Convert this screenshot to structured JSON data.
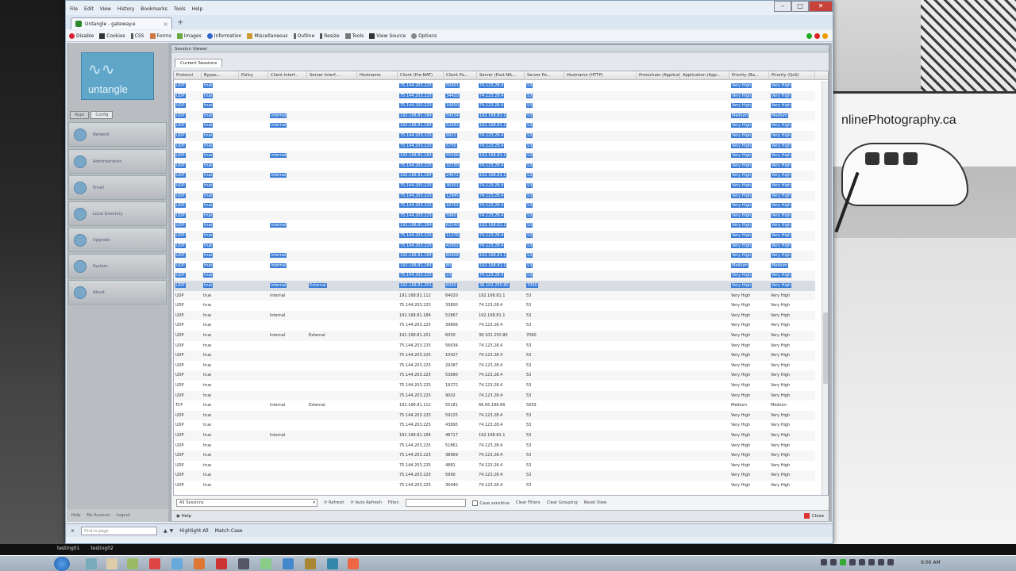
{
  "menu": [
    "File",
    "Edit",
    "View",
    "History",
    "Bookmarks",
    "Tools",
    "Help"
  ],
  "tab": {
    "title": "Untangle - gateway.e"
  },
  "toolbar": [
    "Disable",
    "Cookies",
    "CSS",
    "Forms",
    "Images",
    "Information",
    "Miscellaneous",
    "Outline",
    "Resize",
    "Tools",
    "View Source",
    "Options"
  ],
  "app": {
    "logo": "untangle",
    "tabs": [
      "Apps",
      "Config"
    ],
    "nav": [
      "Network",
      "Administration",
      "Email",
      "Local Directory",
      "Upgrade",
      "System",
      "About"
    ],
    "bottom": [
      "Help",
      "My Account",
      "Logout"
    ]
  },
  "session_viewer": {
    "title": "Session Viewer",
    "tab": "Current Sessions",
    "columns": [
      "Protocol",
      "Bypas...",
      "Policy",
      "Client Interf...",
      "Server Interf...",
      "Hostname",
      "Client (Pre-NAT)",
      "Client Po...",
      "Server (Post-NA...",
      "Server Po...",
      "Hostname (HTTP)",
      "Protochain (Application ...",
      "Application (App...",
      "Priority (Ba...",
      "Priority (QoS)"
    ],
    "selected_rows": [
      [
        "UDP",
        "true",
        "",
        "",
        "",
        "",
        "75.144.203.225",
        "50001",
        "74.123.28.4",
        "53",
        "Very High",
        "Very High"
      ],
      [
        "UDP",
        "true",
        "",
        "",
        "",
        "",
        "75.144.203.225",
        "34420",
        "74.123.28.4",
        "53",
        "Very High",
        "Very High"
      ],
      [
        "UDP",
        "true",
        "",
        "",
        "",
        "",
        "75.144.203.225",
        "16850",
        "74.123.28.4",
        "53",
        "Very High",
        "Very High"
      ],
      [
        "UDP",
        "true",
        "",
        "Internal",
        "",
        "",
        "192.168.81.184",
        "59534",
        "192.168.81.1",
        "53",
        "Medium",
        "Medium"
      ],
      [
        "UDP",
        "true",
        "",
        "Internal",
        "",
        "",
        "192.168.81.184",
        "52993",
        "192.168.81.1",
        "53",
        "Very High",
        "Very High"
      ],
      [
        "UDP",
        "true",
        "",
        "",
        "",
        "",
        "75.144.203.225",
        "9922",
        "74.123.28.4",
        "53",
        "Very High",
        "Very High"
      ],
      [
        "UDP",
        "true",
        "",
        "",
        "",
        "",
        "75.144.203.225",
        "5750",
        "74.123.28.4",
        "53",
        "Very High",
        "Very High"
      ],
      [
        "UDP",
        "true",
        "",
        "Internal",
        "",
        "",
        "192.168.81.184",
        "55596",
        "192.168.81.1",
        "53",
        "Very High",
        "Very High"
      ],
      [
        "UDP",
        "true",
        "",
        "",
        "",
        "",
        "75.144.203.225",
        "32150",
        "74.123.28.4",
        "53",
        "Very High",
        "Very High"
      ],
      [
        "UDP",
        "true",
        "",
        "Internal",
        "",
        "",
        "192.168.81.184",
        "24672",
        "192.168.81.1",
        "53",
        "Very High",
        "Very High"
      ],
      [
        "UDP",
        "true",
        "",
        "",
        "",
        "",
        "75.144.203.225",
        "36301",
        "74.123.28.4",
        "53",
        "Very High",
        "Very High"
      ],
      [
        "UDP",
        "true",
        "",
        "",
        "",
        "",
        "75.144.203.225",
        "12945",
        "74.123.28.4",
        "53",
        "Very High",
        "Very High"
      ],
      [
        "UDP",
        "true",
        "",
        "",
        "",
        "",
        "75.144.203.225",
        "16702",
        "74.123.28.4",
        "53",
        "Very High",
        "Very High"
      ],
      [
        "UDP",
        "true",
        "",
        "",
        "",
        "",
        "75.144.203.225",
        "5960",
        "74.123.28.4",
        "53",
        "Very High",
        "Very High"
      ],
      [
        "UDP",
        "true",
        "",
        "Internal",
        "",
        "",
        "192.168.81.184",
        "62240",
        "192.168.81.1",
        "53",
        "Very High",
        "Very High"
      ],
      [
        "UDP",
        "true",
        "",
        "",
        "",
        "",
        "75.144.203.225",
        "11276",
        "74.123.28.4",
        "53",
        "Very High",
        "Very High"
      ],
      [
        "UDP",
        "true",
        "",
        "",
        "",
        "",
        "75.144.203.225",
        "42002",
        "74.123.28.4",
        "53",
        "Very High",
        "Very High"
      ],
      [
        "UDP",
        "true",
        "",
        "Internal",
        "",
        "",
        "192.168.81.184",
        "60408",
        "192.168.81.1",
        "53",
        "Very High",
        "Very High"
      ],
      [
        "UDP",
        "true",
        "",
        "Internal",
        "",
        "",
        "192.168.81.184",
        "80",
        "192.168.81.1",
        "53",
        "Medium",
        "Medium"
      ],
      [
        "UDP",
        "true",
        "",
        "",
        "",
        "",
        "75.144.203.225",
        "23",
        "74.123.28.4",
        "53",
        "Very High",
        "Very High"
      ],
      [
        "UDP",
        "true",
        "",
        "Internal",
        "External",
        "",
        "192.168.81.201",
        "6050",
        "38.102.250.80",
        "7060",
        "Very High",
        "Very High"
      ]
    ],
    "rows": [
      [
        "UDP",
        "true",
        "",
        "Internal",
        "",
        "",
        "192.168.81.112",
        "64020",
        "192.168.81.1",
        "53",
        "Very High",
        "Very High"
      ],
      [
        "UDP",
        "true",
        "",
        "",
        "",
        "",
        "75.144.203.225",
        "33800",
        "74.123.28.4",
        "53",
        "Very High",
        "Very High"
      ],
      [
        "UDP",
        "true",
        "",
        "Internal",
        "",
        "",
        "192.168.81.184",
        "52867",
        "192.168.81.1",
        "53",
        "Very High",
        "Very High"
      ],
      [
        "UDP",
        "true",
        "",
        "",
        "",
        "",
        "75.144.203.225",
        "39806",
        "74.123.28.4",
        "53",
        "Very High",
        "Very High"
      ],
      [
        "UDP",
        "true",
        "",
        "Internal",
        "External",
        "",
        "192.168.81.201",
        "6050",
        "38.102.250.80",
        "7060",
        "Very High",
        "Very High"
      ],
      [
        "UDP",
        "true",
        "",
        "",
        "",
        "",
        "75.144.203.225",
        "56634",
        "74.123.28.4",
        "53",
        "Very High",
        "Very High"
      ],
      [
        "UDP",
        "true",
        "",
        "",
        "",
        "",
        "75.144.203.225",
        "10427",
        "74.123.28.4",
        "53",
        "Very High",
        "Very High"
      ],
      [
        "UDP",
        "true",
        "",
        "",
        "",
        "",
        "75.144.203.225",
        "29387",
        "74.123.28.4",
        "53",
        "Very High",
        "Very High"
      ],
      [
        "UDP",
        "true",
        "",
        "",
        "",
        "",
        "75.144.203.225",
        "53890",
        "74.123.28.4",
        "53",
        "Very High",
        "Very High"
      ],
      [
        "UDP",
        "true",
        "",
        "",
        "",
        "",
        "75.144.203.225",
        "19272",
        "74.123.28.4",
        "53",
        "Very High",
        "Very High"
      ],
      [
        "UDP",
        "true",
        "",
        "",
        "",
        "",
        "75.144.203.225",
        "9002",
        "74.123.28.4",
        "53",
        "Very High",
        "Very High"
      ],
      [
        "TCP",
        "true",
        "",
        "Internal",
        "External",
        "",
        "192.168.81.112",
        "55181",
        "66.65.188.66",
        "5003",
        "Medium",
        "Medium"
      ],
      [
        "UDP",
        "true",
        "",
        "",
        "",
        "",
        "75.144.203.225",
        "59225",
        "74.123.28.4",
        "53",
        "Very High",
        "Very High"
      ],
      [
        "UDP",
        "true",
        "",
        "",
        "",
        "",
        "75.144.203.225",
        "43895",
        "74.123.28.4",
        "53",
        "Very High",
        "Very High"
      ],
      [
        "UDP",
        "true",
        "",
        "Internal",
        "",
        "",
        "192.168.81.184",
        "48717",
        "192.168.81.1",
        "53",
        "Very High",
        "Very High"
      ],
      [
        "UDP",
        "true",
        "",
        "",
        "",
        "",
        "75.144.203.225",
        "51861",
        "74.123.28.4",
        "53",
        "Very High",
        "Very High"
      ],
      [
        "UDP",
        "true",
        "",
        "",
        "",
        "",
        "75.144.203.225",
        "38969",
        "74.123.28.4",
        "53",
        "Very High",
        "Very High"
      ],
      [
        "UDP",
        "true",
        "",
        "",
        "",
        "",
        "75.144.203.225",
        "4881",
        "74.123.28.4",
        "53",
        "Very High",
        "Very High"
      ],
      [
        "UDP",
        "true",
        "",
        "",
        "",
        "",
        "75.144.203.225",
        "5990",
        "74.123.28.4",
        "53",
        "Very High",
        "Very High"
      ],
      [
        "UDP",
        "true",
        "",
        "",
        "",
        "",
        "75.144.203.225",
        "30440",
        "74.123.28.4",
        "53",
        "Very High",
        "Very High"
      ]
    ],
    "footer": {
      "select": "All Sessions",
      "refresh": "Refresh",
      "auto_refresh": "Auto Refresh",
      "filter_label": "Filter:",
      "case": "Case sensitive",
      "clear_filters": "Clear Filters",
      "clear_grouping": "Clear Grouping",
      "reset_view": "Reset View"
    },
    "help": "Help",
    "close": "Close"
  },
  "findbar": {
    "placeholder": "Find in page",
    "highlight": "Highlight All",
    "match_case": "Match Case"
  },
  "bottom_labels": [
    "testing01",
    "testing02"
  ],
  "background_sign": "nlinePhotography.ca",
  "clock": "9:00 AM"
}
